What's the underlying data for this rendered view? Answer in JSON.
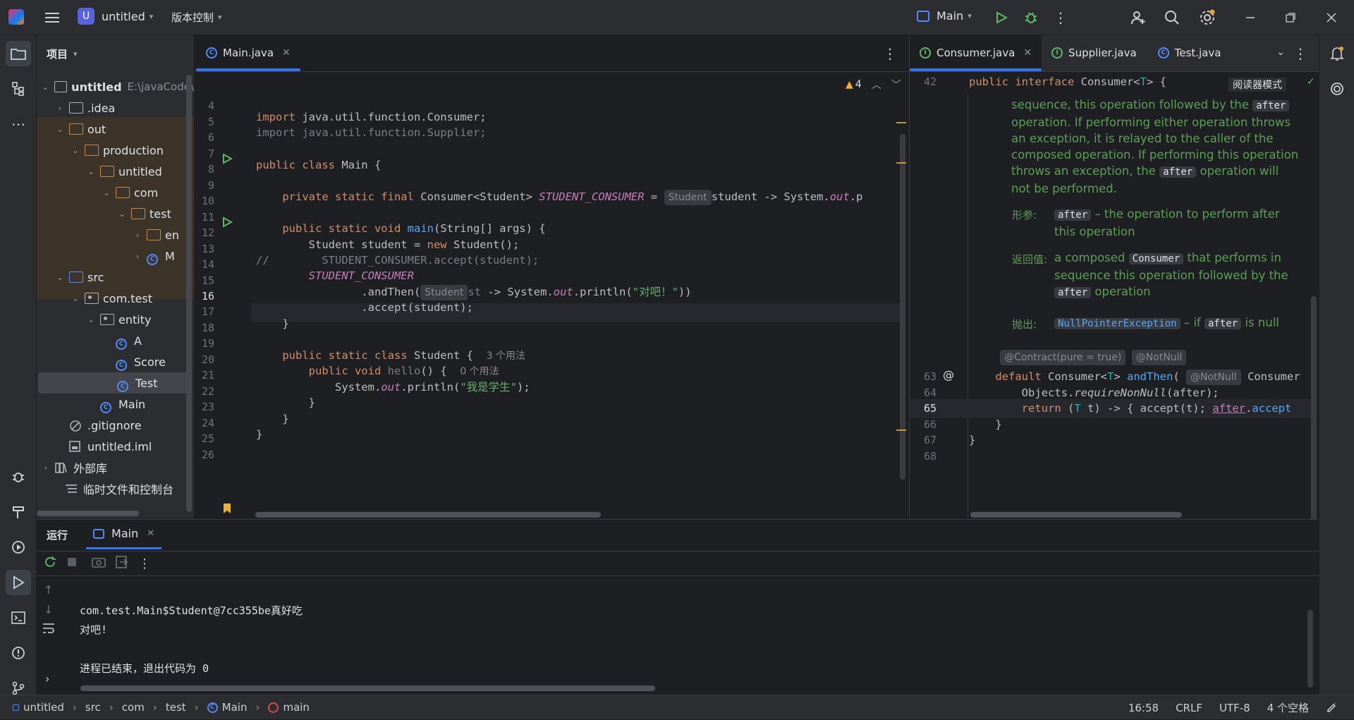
{
  "titlebar": {
    "project_badge": "U",
    "project_name": "untitled",
    "vcs": "版本控制",
    "run_config": "Main"
  },
  "project": {
    "title": "项目",
    "root_name": "untitled",
    "root_path": "E:\\javaCode\\",
    "items": [
      {
        "label": ".idea"
      },
      {
        "label": "out"
      },
      {
        "label": "production"
      },
      {
        "label": "untitled"
      },
      {
        "label": "com"
      },
      {
        "label": "test"
      },
      {
        "label": "en"
      },
      {
        "label": "M"
      },
      {
        "label": "src"
      },
      {
        "label": "com.test"
      },
      {
        "label": "entity"
      },
      {
        "label": "A"
      },
      {
        "label": "Score"
      },
      {
        "label": "Test"
      },
      {
        "label": "Main"
      },
      {
        "label": ".gitignore"
      },
      {
        "label": "untitled.iml"
      },
      {
        "label": "外部库"
      },
      {
        "label": "临时文件和控制台"
      }
    ]
  },
  "editor": {
    "tab": "Main.java",
    "warnings": "4",
    "line_numbers": [
      "4",
      "5",
      "6",
      "7",
      "8",
      "9",
      "10",
      "11",
      "12",
      "13",
      "14",
      "15",
      "16",
      "17",
      "18",
      "19",
      "20",
      "21",
      "22",
      "23",
      "24",
      "25",
      "26"
    ],
    "hints": {
      "student": "Student",
      "usages3": "3 个用法",
      "usages0": "0 个用法"
    }
  },
  "editor2": {
    "tabs": [
      "Consumer.java",
      "Supplier.java",
      "Test.java"
    ],
    "reader_mode": "阅读器模式",
    "line_numbers": {
      "l42": "42",
      "l63": "63",
      "l64": "64",
      "l65": "65",
      "l66": "66",
      "l67": "67",
      "l68": "68"
    },
    "doc": {
      "p1": "sequence, this operation followed by the",
      "after": "after",
      "p2": "operation. If performing either operation throws an exception, it is relayed to the caller of the composed operation. If performing this operation throws an exception, the",
      "p3": "operation will not be performed.",
      "param_label": "形参:",
      "param_text": "– the operation to perform after this operation",
      "return_label": "返回值:",
      "return_a": "a composed",
      "consumer": "Consumer",
      "return_b": "that performs in sequence this operation followed by the",
      "return_c": "operation",
      "throws_label": "抛出:",
      "npe": "NullPointerException",
      "throws_a": "– if",
      "throws_b": "is null",
      "contract": "@Contract(pure = true)",
      "notnull": "@NotNull"
    }
  },
  "run": {
    "title": "运行",
    "tab": "Main",
    "output": [
      "com.test.Main$Student@7cc355be真好吃",
      "对吧!",
      "",
      "进程已结束，退出代码为 0"
    ]
  },
  "statusbar": {
    "crumbs": [
      "untitled",
      "src",
      "com",
      "test",
      "Main",
      "main"
    ],
    "position": "16:58",
    "line_sep": "CRLF",
    "encoding": "UTF-8",
    "indent": "4 个空格"
  }
}
